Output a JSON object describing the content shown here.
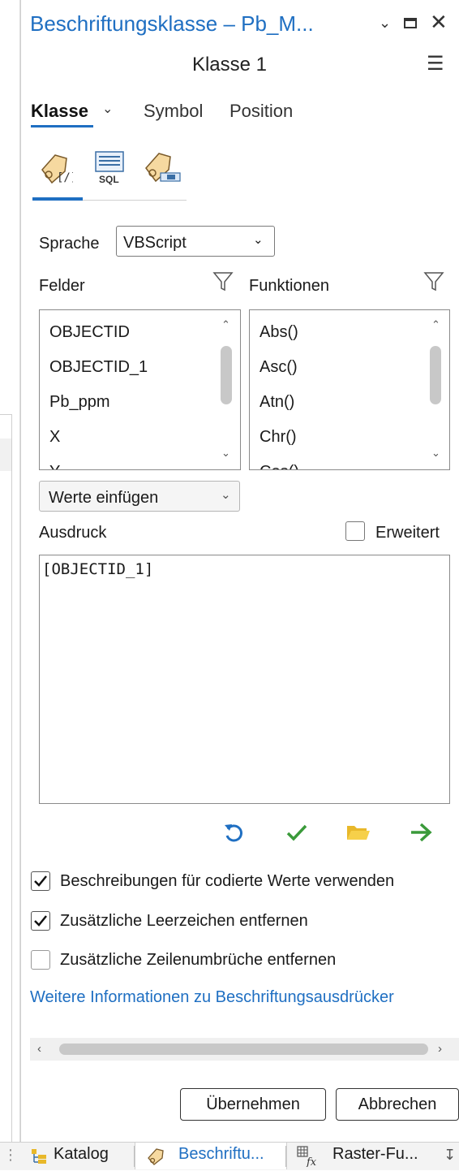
{
  "window": {
    "title": "Beschriftungsklasse – Pb_M...",
    "subtitle": "Klasse 1"
  },
  "tabs": {
    "klasse": "Klasse",
    "symbol": "Symbol",
    "position": "Position"
  },
  "tools": {
    "sql_label": "SQL"
  },
  "language": {
    "label": "Sprache",
    "value": "VBScript"
  },
  "fields": {
    "label": "Felder",
    "items": [
      "OBJECTID",
      "OBJECTID_1",
      "Pb_ppm",
      "X",
      "Y"
    ]
  },
  "functions": {
    "label": "Funktionen",
    "items": [
      "Abs()",
      "Asc()",
      "Atn()",
      "Chr()",
      "Cos()"
    ]
  },
  "insert_values": {
    "value": "Werte einfügen"
  },
  "expression": {
    "label": "Ausdruck",
    "advanced_label": "Erweitert",
    "text": "[OBJECTID_1]"
  },
  "options": [
    {
      "label": "Beschreibungen für codierte Werte verwenden",
      "checked": true
    },
    {
      "label": "Zusätzliche Leerzeichen entfernen",
      "checked": true
    },
    {
      "label": "Zusätzliche Zeilenumbrüche entfernen",
      "checked": false
    }
  ],
  "more_info_link": "Weitere Informationen zu Beschriftungsausdrücker",
  "buttons": {
    "apply": "Übernehmen",
    "cancel": "Abbrechen"
  },
  "bottom_tabs": {
    "katalog": "Katalog",
    "beschriftung": "Beschriftu...",
    "raster": "Raster-Fu..."
  },
  "colors": {
    "accent": "#1f6fc2",
    "check_green": "#3a9a3a",
    "folder_yellow": "#f0c419"
  }
}
